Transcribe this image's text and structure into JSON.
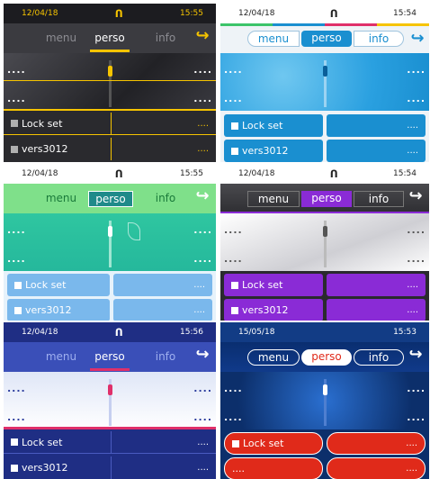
{
  "variants": [
    {
      "date": "12/04/18",
      "time": "15:55",
      "tabs": [
        "menu",
        "perso",
        "info"
      ],
      "keys": [
        "Lock set",
        "vers3012"
      ],
      "dots": "....",
      "accent": "#f6c400"
    },
    {
      "date": "12/04/18",
      "time": "15:54",
      "tabs": [
        "menu",
        "perso",
        "info"
      ],
      "keys": [
        "Lock set",
        "vers3012"
      ],
      "dots": "....",
      "accent": "#1a8fd0"
    },
    {
      "date": "12/04/18",
      "time": "15:55",
      "tabs": [
        "menu",
        "perso",
        "info"
      ],
      "keys": [
        "Lock set",
        "vers3012"
      ],
      "dots": "....",
      "accent": "#2bbfa0"
    },
    {
      "date": "12/04/18",
      "time": "15:54",
      "tabs": [
        "menu",
        "perso",
        "info"
      ],
      "keys": [
        "Lock set",
        "vers3012"
      ],
      "dots": "....",
      "accent": "#8a2bd6"
    },
    {
      "date": "12/04/18",
      "time": "15:56",
      "tabs": [
        "menu",
        "perso",
        "info"
      ],
      "keys": [
        "Lock set",
        "vers3012"
      ],
      "dots": "....",
      "accent": "#e0306a"
    },
    {
      "date": "15/05/18",
      "time": "15:53",
      "tabs": [
        "menu",
        "perso",
        "info"
      ],
      "keys": [
        "Lock set"
      ],
      "dots": "....",
      "accent": "#e02a1a"
    }
  ],
  "icons": {
    "status": "headset-icon",
    "hook": "offhook-arrow-icon"
  }
}
